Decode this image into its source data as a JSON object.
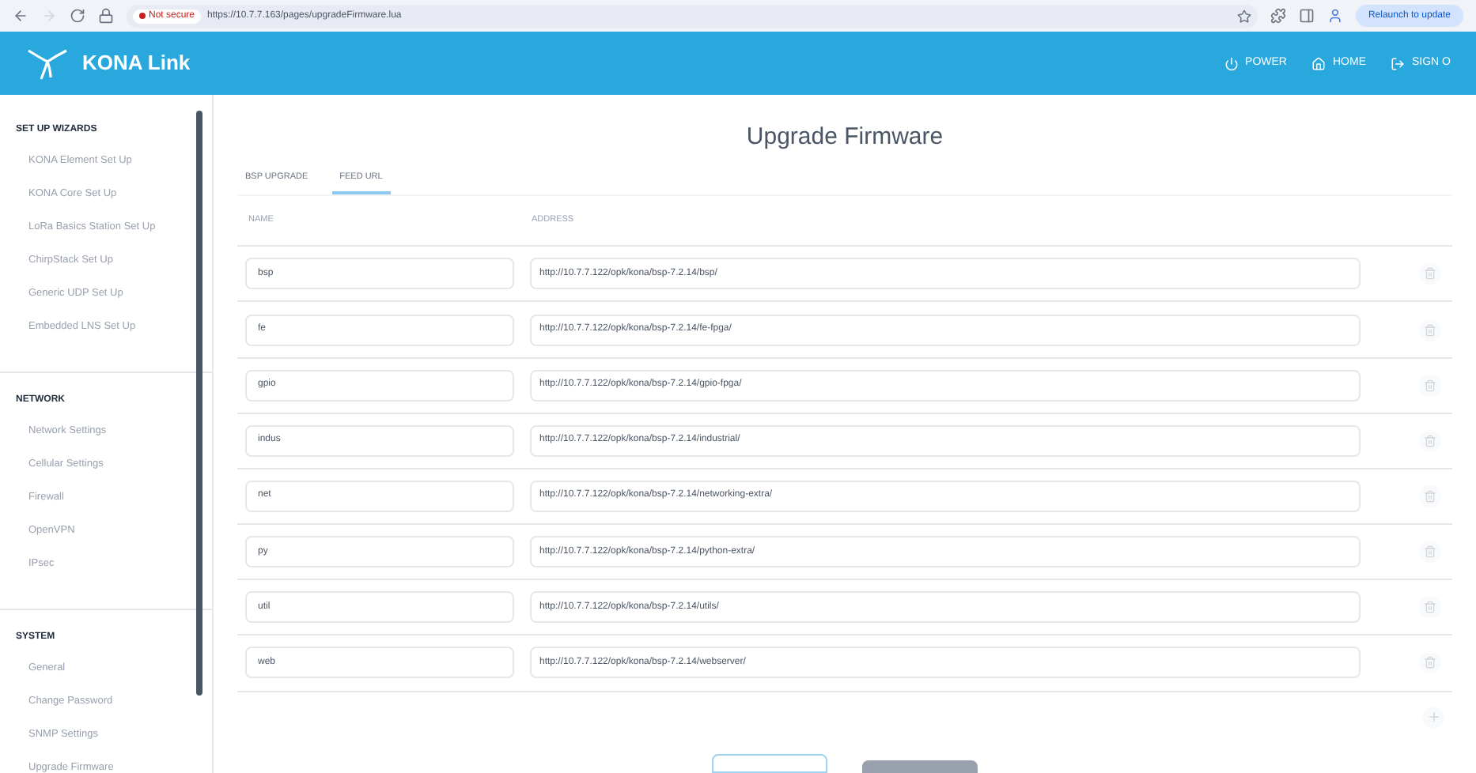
{
  "browser": {
    "security": "Not secure",
    "url": "https://10.7.7.163/pages/upgradeFirmware.lua",
    "update_button": "Relaunch to update"
  },
  "header": {
    "title": "KONA Link",
    "actions": [
      "POWER",
      "HOME",
      "SIGN O"
    ]
  },
  "sidebar": {
    "sections": [
      {
        "title": "SET UP WIZARDS",
        "items": [
          {
            "label": "KONA Element Set Up",
            "selected": false
          },
          {
            "label": "KONA Core Set Up",
            "selected": false
          },
          {
            "label": "LoRa Basics Station Set Up",
            "selected": false
          },
          {
            "label": "ChirpStack Set Up",
            "selected": false
          },
          {
            "label": "Generic UDP Set Up",
            "selected": false
          },
          {
            "label": "Embedded LNS Set Up",
            "selected": false
          }
        ]
      },
      {
        "title": "NETWORK",
        "items": [
          {
            "label": "Network Settings",
            "selected": false
          },
          {
            "label": "Cellular Settings",
            "selected": false
          },
          {
            "label": "Firewall",
            "selected": false
          },
          {
            "label": "OpenVPN",
            "selected": false
          },
          {
            "label": "IPsec",
            "selected": false
          }
        ]
      },
      {
        "title": "SYSTEM",
        "items": [
          {
            "label": "General",
            "selected": false
          },
          {
            "label": "Change Password",
            "selected": false
          },
          {
            "label": "SNMP Settings",
            "selected": false
          },
          {
            "label": "Upgrade Firmware",
            "selected": false
          }
        ]
      }
    ]
  },
  "page": {
    "title": "Upgrade Firmware",
    "tabs": [
      {
        "label": "BSP UPGRADE",
        "selected": false
      },
      {
        "label": "FEED URL",
        "selected": true
      }
    ],
    "columns": [
      "NAME",
      "ADDRESS"
    ],
    "feeds": [
      {
        "name": "bsp",
        "address": "http://10.7.7.122/opk/kona/bsp-7.2.14/bsp/"
      },
      {
        "name": "fe",
        "address": "http://10.7.7.122/opk/kona/bsp-7.2.14/fe-fpga/"
      },
      {
        "name": "gpio",
        "address": "http://10.7.7.122/opk/kona/bsp-7.2.14/gpio-fpga/"
      },
      {
        "name": "indus",
        "address": "http://10.7.7.122/opk/kona/bsp-7.2.14/industrial/"
      },
      {
        "name": "net",
        "address": "http://10.7.7.122/opk/kona/bsp-7.2.14/networking-extra/"
      },
      {
        "name": "py",
        "address": "http://10.7.7.122/opk/kona/bsp-7.2.14/python-extra/"
      },
      {
        "name": "util",
        "address": "http://10.7.7.122/opk/kona/bsp-7.2.14/utils/"
      },
      {
        "name": "web",
        "address": "http://10.7.7.122/opk/kona/bsp-7.2.14/webserver/"
      }
    ]
  }
}
